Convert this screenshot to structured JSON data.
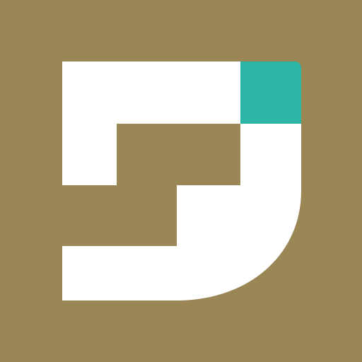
{
  "app_icon": {
    "name": "brand-logo-icon",
    "colors": {
      "background": "#9b8656",
      "primary_shape": "#ffffff",
      "accent_square": "#2ab5a7"
    }
  }
}
